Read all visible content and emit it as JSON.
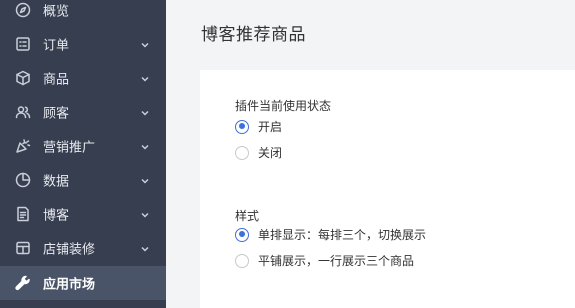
{
  "sidebar": {
    "items": [
      {
        "label": "概览",
        "icon": "compass-icon",
        "has_chevron": false,
        "active": false
      },
      {
        "label": "订单",
        "icon": "order-list-icon",
        "has_chevron": true,
        "active": false
      },
      {
        "label": "商品",
        "icon": "package-box-icon",
        "has_chevron": true,
        "active": false
      },
      {
        "label": "顾客",
        "icon": "users-icon",
        "has_chevron": true,
        "active": false
      },
      {
        "label": "营销推广",
        "icon": "party-popper-icon",
        "has_chevron": true,
        "active": false
      },
      {
        "label": "数据",
        "icon": "pie-chart-icon",
        "has_chevron": true,
        "active": false
      },
      {
        "label": "博客",
        "icon": "document-icon",
        "has_chevron": true,
        "active": false
      },
      {
        "label": "店铺装修",
        "icon": "layout-icon",
        "has_chevron": true,
        "active": false
      },
      {
        "label": "应用市场",
        "icon": "wrench-icon",
        "has_chevron": false,
        "active": true
      }
    ]
  },
  "main": {
    "title": "博客推荐商品",
    "status_section": {
      "label": "插件当前使用状态",
      "options": [
        {
          "label": "开启",
          "checked": true
        },
        {
          "label": "关闭",
          "checked": false
        }
      ]
    },
    "style_section": {
      "label": "样式",
      "options": [
        {
          "label": "单排显示：每排三个，切换展示",
          "checked": true
        },
        {
          "label": "平铺展示，一行展示三个商品",
          "checked": false
        }
      ]
    }
  },
  "colors": {
    "sidebar_bg": "#363e4f",
    "sidebar_active_bg": "#4a5468",
    "accent": "#3f6fd8",
    "page_bg": "#f3f4f6"
  }
}
